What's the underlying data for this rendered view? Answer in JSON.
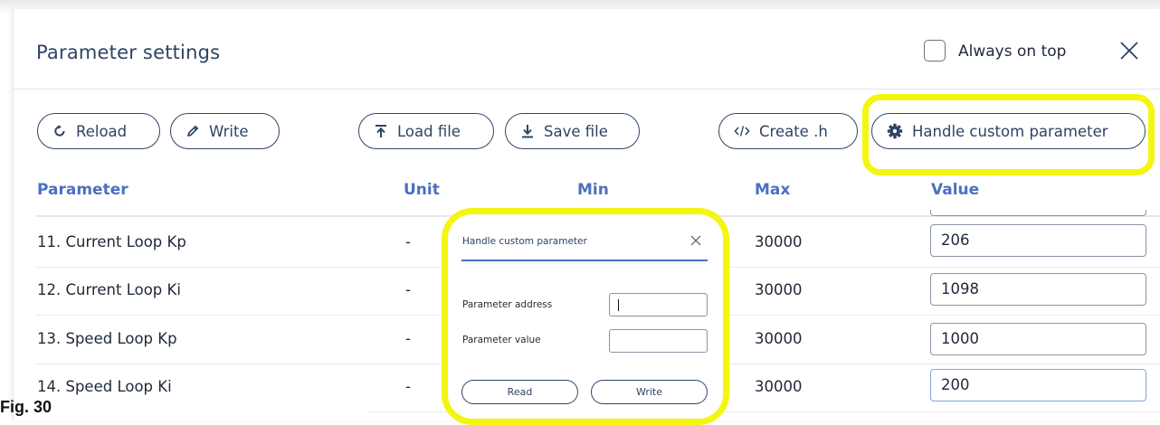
{
  "window": {
    "title": "Parameter settings",
    "always_on_top_label": "Always on top",
    "always_on_top_checked": false
  },
  "toolbar": {
    "reload_label": "Reload",
    "write_label": "Write",
    "load_file_label": "Load file",
    "save_file_label": "Save file",
    "create_h_label": "Create .h",
    "handle_custom_label": "Handle custom parameter"
  },
  "table": {
    "headers": {
      "parameter": "Parameter",
      "unit": "Unit",
      "min": "Min",
      "max": "Max",
      "value": "Value"
    },
    "rows": [
      {
        "parameter": "11. Current Loop Kp",
        "unit": "-",
        "max": "30000",
        "value": "206"
      },
      {
        "parameter": "12. Current Loop Ki",
        "unit": "-",
        "max": "30000",
        "value": "1098"
      },
      {
        "parameter": "13. Speed Loop Kp",
        "unit": "-",
        "max": "30000",
        "value": "1000"
      },
      {
        "parameter": "14. Speed Loop Ki",
        "unit": "-",
        "max": "30000",
        "value": "200"
      }
    ]
  },
  "dialog": {
    "title": "Handle custom parameter",
    "address_label": "Parameter address",
    "address_value": "",
    "value_label": "Parameter value",
    "value_value": "",
    "read_label": "Read",
    "write_label": "Write"
  },
  "caption": "Fig. 30",
  "colors": {
    "primary": "#2e4364",
    "header_text": "#4a70c0",
    "highlight": "#f4f511"
  }
}
